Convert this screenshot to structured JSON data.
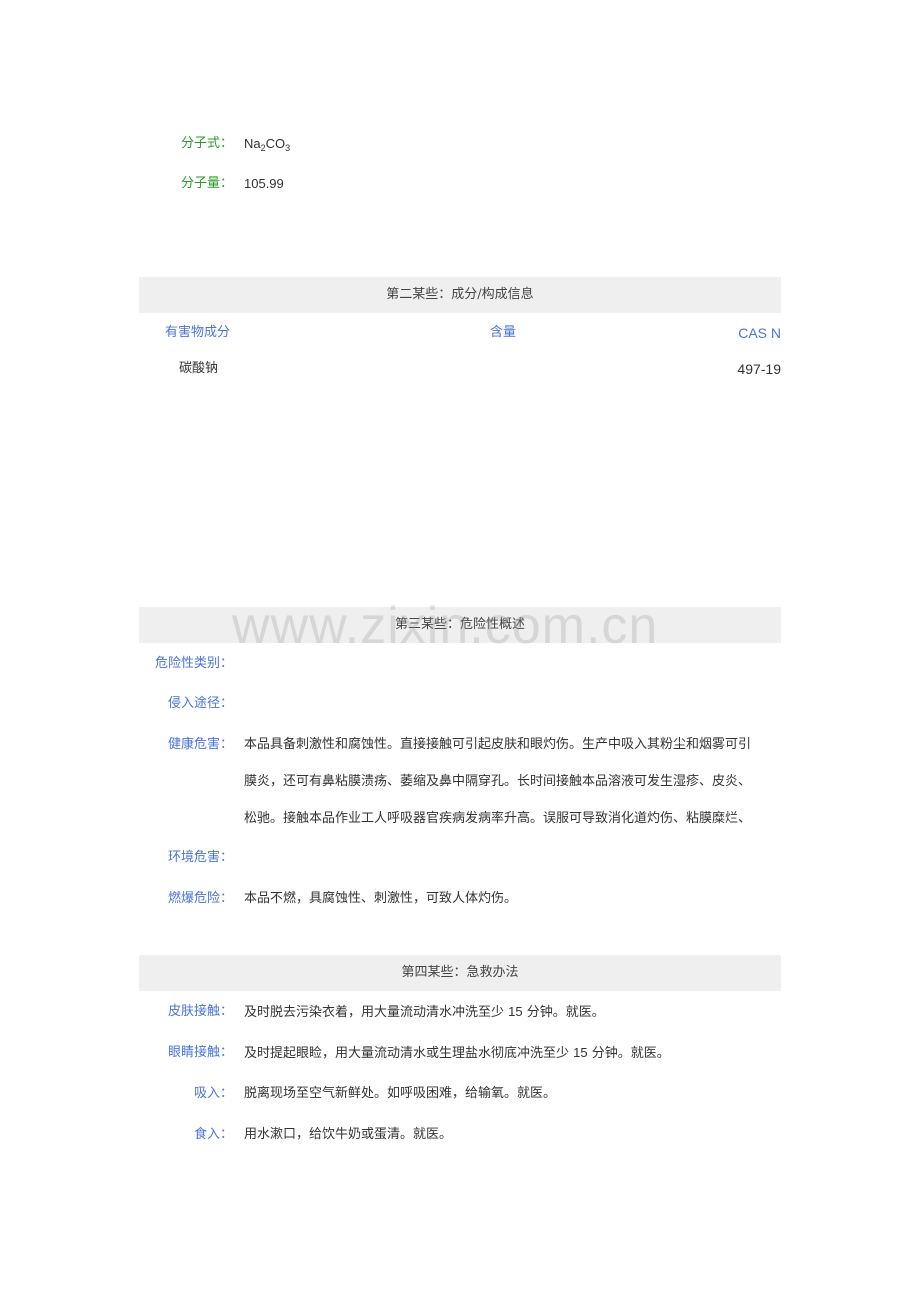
{
  "identity": {
    "formula_label": "分子式：",
    "formula_main_1": "Na",
    "formula_sub_1": "2",
    "formula_main_2": "CO",
    "formula_sub_2": "3",
    "weight_label": "分子量：",
    "weight_value": "105.99"
  },
  "section2": {
    "title": "第二某些：成分/构成信息",
    "headers": {
      "component": "有害物成分",
      "content": "含量",
      "cas": "CAS N"
    },
    "rows": [
      {
        "component": "碳酸钠",
        "content": "",
        "cas": "497-19"
      }
    ]
  },
  "section3": {
    "title": "第三某些：危险性概述",
    "hazard_class_label": "危险性类别：",
    "hazard_class_value": "",
    "route_label": "侵入途径：",
    "route_value": "",
    "health_label": "健康危害：",
    "health_lines": [
      "本品具备刺激性和腐蚀性。直接接触可引起皮肤和眼灼伤。生产中吸入其粉尘和烟雾可引",
      "膜炎，还可有鼻粘膜溃疡、萎缩及鼻中隔穿孔。长时间接触本品溶液可发生湿疹、皮炎、",
      "松驰。接触本品作业工人呼吸器官疾病发病率升高。误服可导致消化道灼伤、粘膜糜烂、"
    ],
    "env_label": "环境危害：",
    "env_value": "",
    "fire_label": "燃爆危险：",
    "fire_value": "本品不燃，具腐蚀性、刺激性，可致人体灼伤。"
  },
  "section4": {
    "title": "第四某些：急救办法",
    "items": [
      {
        "label": "皮肤接触：",
        "value_before": "及时脱去污染衣着，用大量流动清水冲洗至少 ",
        "num": "15",
        "value_after": " 分钟。就医。"
      },
      {
        "label": "眼睛接触：",
        "value_before": "及时提起眼睑，用大量流动清水或生理盐水彻底冲洗至少 ",
        "num": "15",
        "value_after": " 分钟。就医。"
      },
      {
        "label": "吸入：",
        "value_before": "脱离现场至空气新鲜处。如呼吸困难，给输氧。就医。",
        "num": "",
        "value_after": ""
      },
      {
        "label": "食入：",
        "value_before": "用水漱口，给饮牛奶或蛋清。就医。",
        "num": "",
        "value_after": ""
      }
    ]
  },
  "watermark": "www.zixin.com.cn"
}
